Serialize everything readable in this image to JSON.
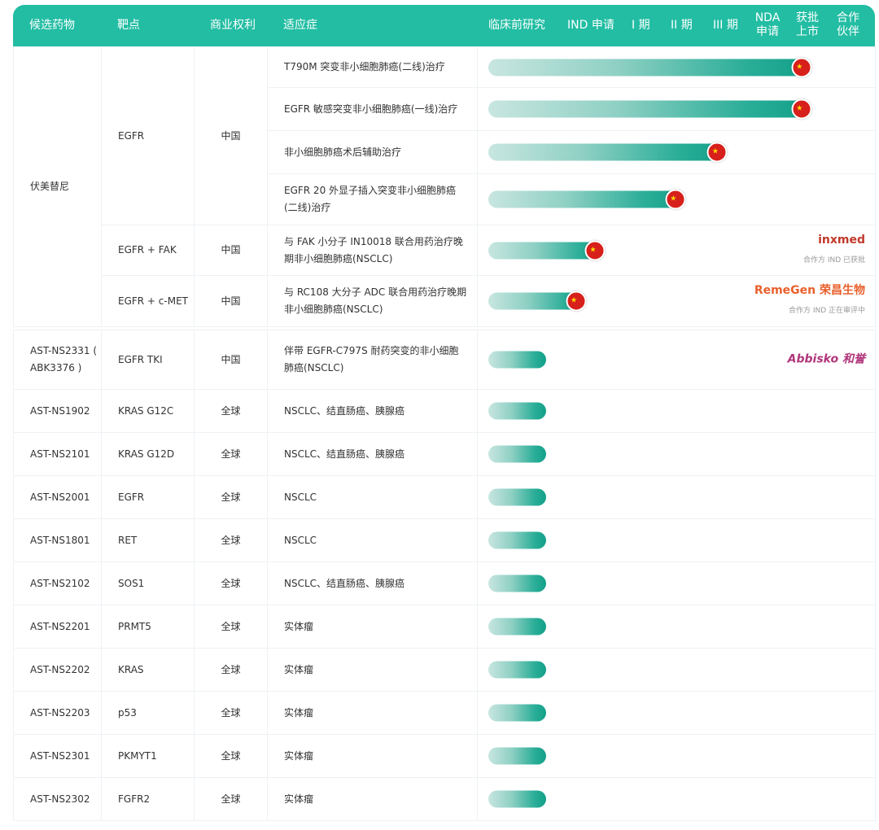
{
  "header": [
    "候选药物",
    "靶点",
    "商业权利",
    "适应症",
    "临床前研究",
    "IND 申请",
    "I 期",
    "II 期",
    "III 期",
    "NDA 申请",
    "获批 上市",
    "合作 伙伴"
  ],
  "colors": {
    "header": "#22bda3",
    "bar_end": "#12a08a",
    "flag": "#d7201b"
  },
  "furmonertinib": {
    "name": "伏美替尼",
    "groups": [
      {
        "target": "EGFR",
        "rights": "中国",
        "rows": [
          {
            "indication": "T790M 突变非小细胞肺癌(二线)治疗",
            "progress": 84,
            "flag": "china-flag-icon"
          },
          {
            "indication": "EGFR 敏感突变非小细胞肺癌(一线)治疗",
            "progress": 84,
            "flag": "china-flag-icon"
          },
          {
            "indication": "非小细胞肺癌术后辅助治疗",
            "progress": 62,
            "flag": "china-flag-icon"
          },
          {
            "indication": "EGFR 20 外显子插入突变非小细胞肺癌(二线)治疗",
            "progress": 51,
            "flag": "china-flag-icon"
          }
        ]
      },
      {
        "target": "EGFR + FAK",
        "rights": "中国",
        "rows": [
          {
            "indication": "与 FAK 小分子 IN10018 联合用药治疗晚期非小细胞肺癌(NSCLC)",
            "progress": 30,
            "flag": "china-flag-icon",
            "partner": "inxmed",
            "partner_note": "合作方 IND 已获批"
          }
        ]
      },
      {
        "target": "EGFR + c-MET",
        "rights": "中国",
        "rows": [
          {
            "indication": "与 RC108 大分子 ADC 联合用药治疗晚期非小细胞肺癌(NSCLC)",
            "progress": 25,
            "flag": "china-flag-icon",
            "partner": "RemeGen 荣昌生物",
            "partner_note": "合作方 IND 正在审评中"
          }
        ]
      }
    ]
  },
  "others": [
    {
      "drug": "AST-NS2331 ( ABK3376 )",
      "target": "EGFR TKI",
      "rights": "中国",
      "indication": "伴带 EGFR-C797S 耐药突变的非小细胞肺癌(NSCLC)",
      "progress": 15,
      "partner": "Abbisko 和誉"
    },
    {
      "drug": "AST-NS1902",
      "target": "KRAS G12C",
      "rights": "全球",
      "indication": "NSCLC、结直肠癌、胰腺癌",
      "progress": 15
    },
    {
      "drug": "AST-NS2101",
      "target": "KRAS G12D",
      "rights": "全球",
      "indication": "NSCLC、结直肠癌、胰腺癌",
      "progress": 15
    },
    {
      "drug": "AST-NS2001",
      "target": "EGFR",
      "rights": "全球",
      "indication": "NSCLC",
      "progress": 15
    },
    {
      "drug": "AST-NS1801",
      "target": "RET",
      "rights": "全球",
      "indication": "NSCLC",
      "progress": 15
    },
    {
      "drug": "AST-NS2102",
      "target": "SOS1",
      "rights": "全球",
      "indication": "NSCLC、结直肠癌、胰腺癌",
      "progress": 15
    },
    {
      "drug": "AST-NS2201",
      "target": "PRMT5",
      "rights": "全球",
      "indication": "实体瘤",
      "progress": 15
    },
    {
      "drug": "AST-NS2202",
      "target": "KRAS",
      "rights": "全球",
      "indication": "实体瘤",
      "progress": 15
    },
    {
      "drug": "AST-NS2203",
      "target": "p53",
      "rights": "全球",
      "indication": "实体瘤",
      "progress": 15
    },
    {
      "drug": "AST-NS2301",
      "target": "PKMYT1",
      "rights": "全球",
      "indication": "实体瘤",
      "progress": 15
    },
    {
      "drug": "AST-NS2302",
      "target": "FGFR2",
      "rights": "全球",
      "indication": "实体瘤",
      "progress": 15
    }
  ]
}
